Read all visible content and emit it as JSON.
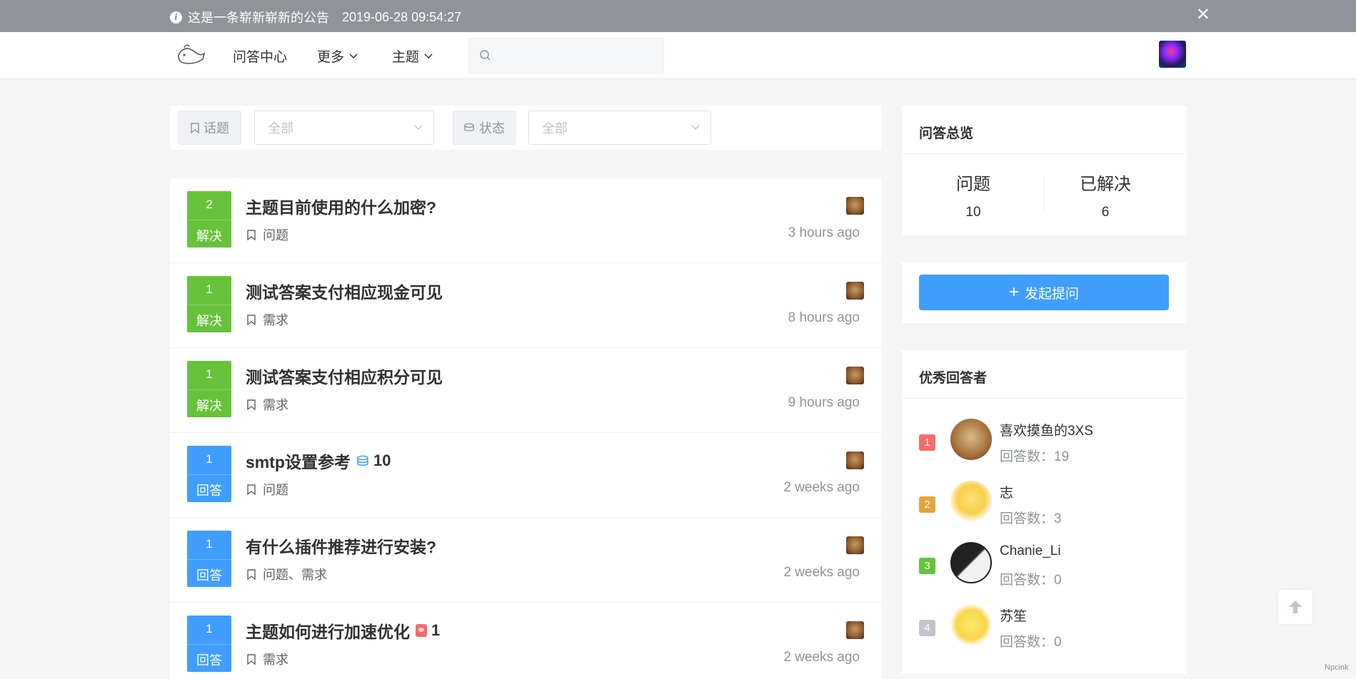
{
  "announcement": {
    "text": "这是一条崭新崭新的公告",
    "date": "2019-06-28 09:54:27"
  },
  "header": {
    "nav": [
      {
        "label": "问答中心"
      },
      {
        "label": "更多"
      },
      {
        "label": "主题"
      }
    ],
    "search_placeholder": ""
  },
  "filter": {
    "topic_label": "话题",
    "topic_value": "全部",
    "status_label": "状态",
    "status_value": "全部"
  },
  "questions": [
    {
      "count": "2",
      "status": "解决",
      "type": "solved",
      "title": "主题目前使用的什么加密?",
      "reward": "",
      "tags": "问题",
      "time": "3 hours ago"
    },
    {
      "count": "1",
      "status": "解决",
      "type": "solved",
      "title": "测试答案支付相应现金可见",
      "reward": "",
      "tags": "需求",
      "time": "8 hours ago"
    },
    {
      "count": "1",
      "status": "解决",
      "type": "solved",
      "title": "测试答案支付相应积分可见",
      "reward": "",
      "tags": "需求",
      "time": "9 hours ago"
    },
    {
      "count": "1",
      "status": "回答",
      "type": "answered",
      "title": "smtp设置参考",
      "reward": "10",
      "reward_icon": "coin-icon",
      "tags": "问题",
      "time": "2 weeks ago"
    },
    {
      "count": "1",
      "status": "回答",
      "type": "answered",
      "title": "有什么插件推荐进行安装?",
      "reward": "",
      "tags": "问题、需求",
      "time": "2 weeks ago"
    },
    {
      "count": "1",
      "status": "回答",
      "type": "answered",
      "title": "主题如何进行加速优化",
      "reward": "1",
      "reward_icon": "red-packet-icon",
      "tags": "需求",
      "time": "2 weeks ago"
    }
  ],
  "overview": {
    "title": "问答总览",
    "questions_label": "问题",
    "questions_value": "10",
    "solved_label": "已解决",
    "solved_value": "6"
  },
  "ask_button": "发起提问",
  "top_answerers": {
    "title": "优秀回答者",
    "items": [
      {
        "rank": "1",
        "name": "喜欢摸鱼的3XS",
        "count": "回答数：19",
        "rank_color": "#f56c6c"
      },
      {
        "rank": "2",
        "name": "志",
        "count": "回答数：3",
        "rank_color": "#e6a23c"
      },
      {
        "rank": "3",
        "name": "Chanie_Li",
        "count": "回答数：0",
        "rank_color": "#67c23a"
      },
      {
        "rank": "4",
        "name": "苏笙",
        "count": "回答数：0",
        "rank_color": "#c0c4cc"
      }
    ]
  },
  "watermark": "Npcink"
}
